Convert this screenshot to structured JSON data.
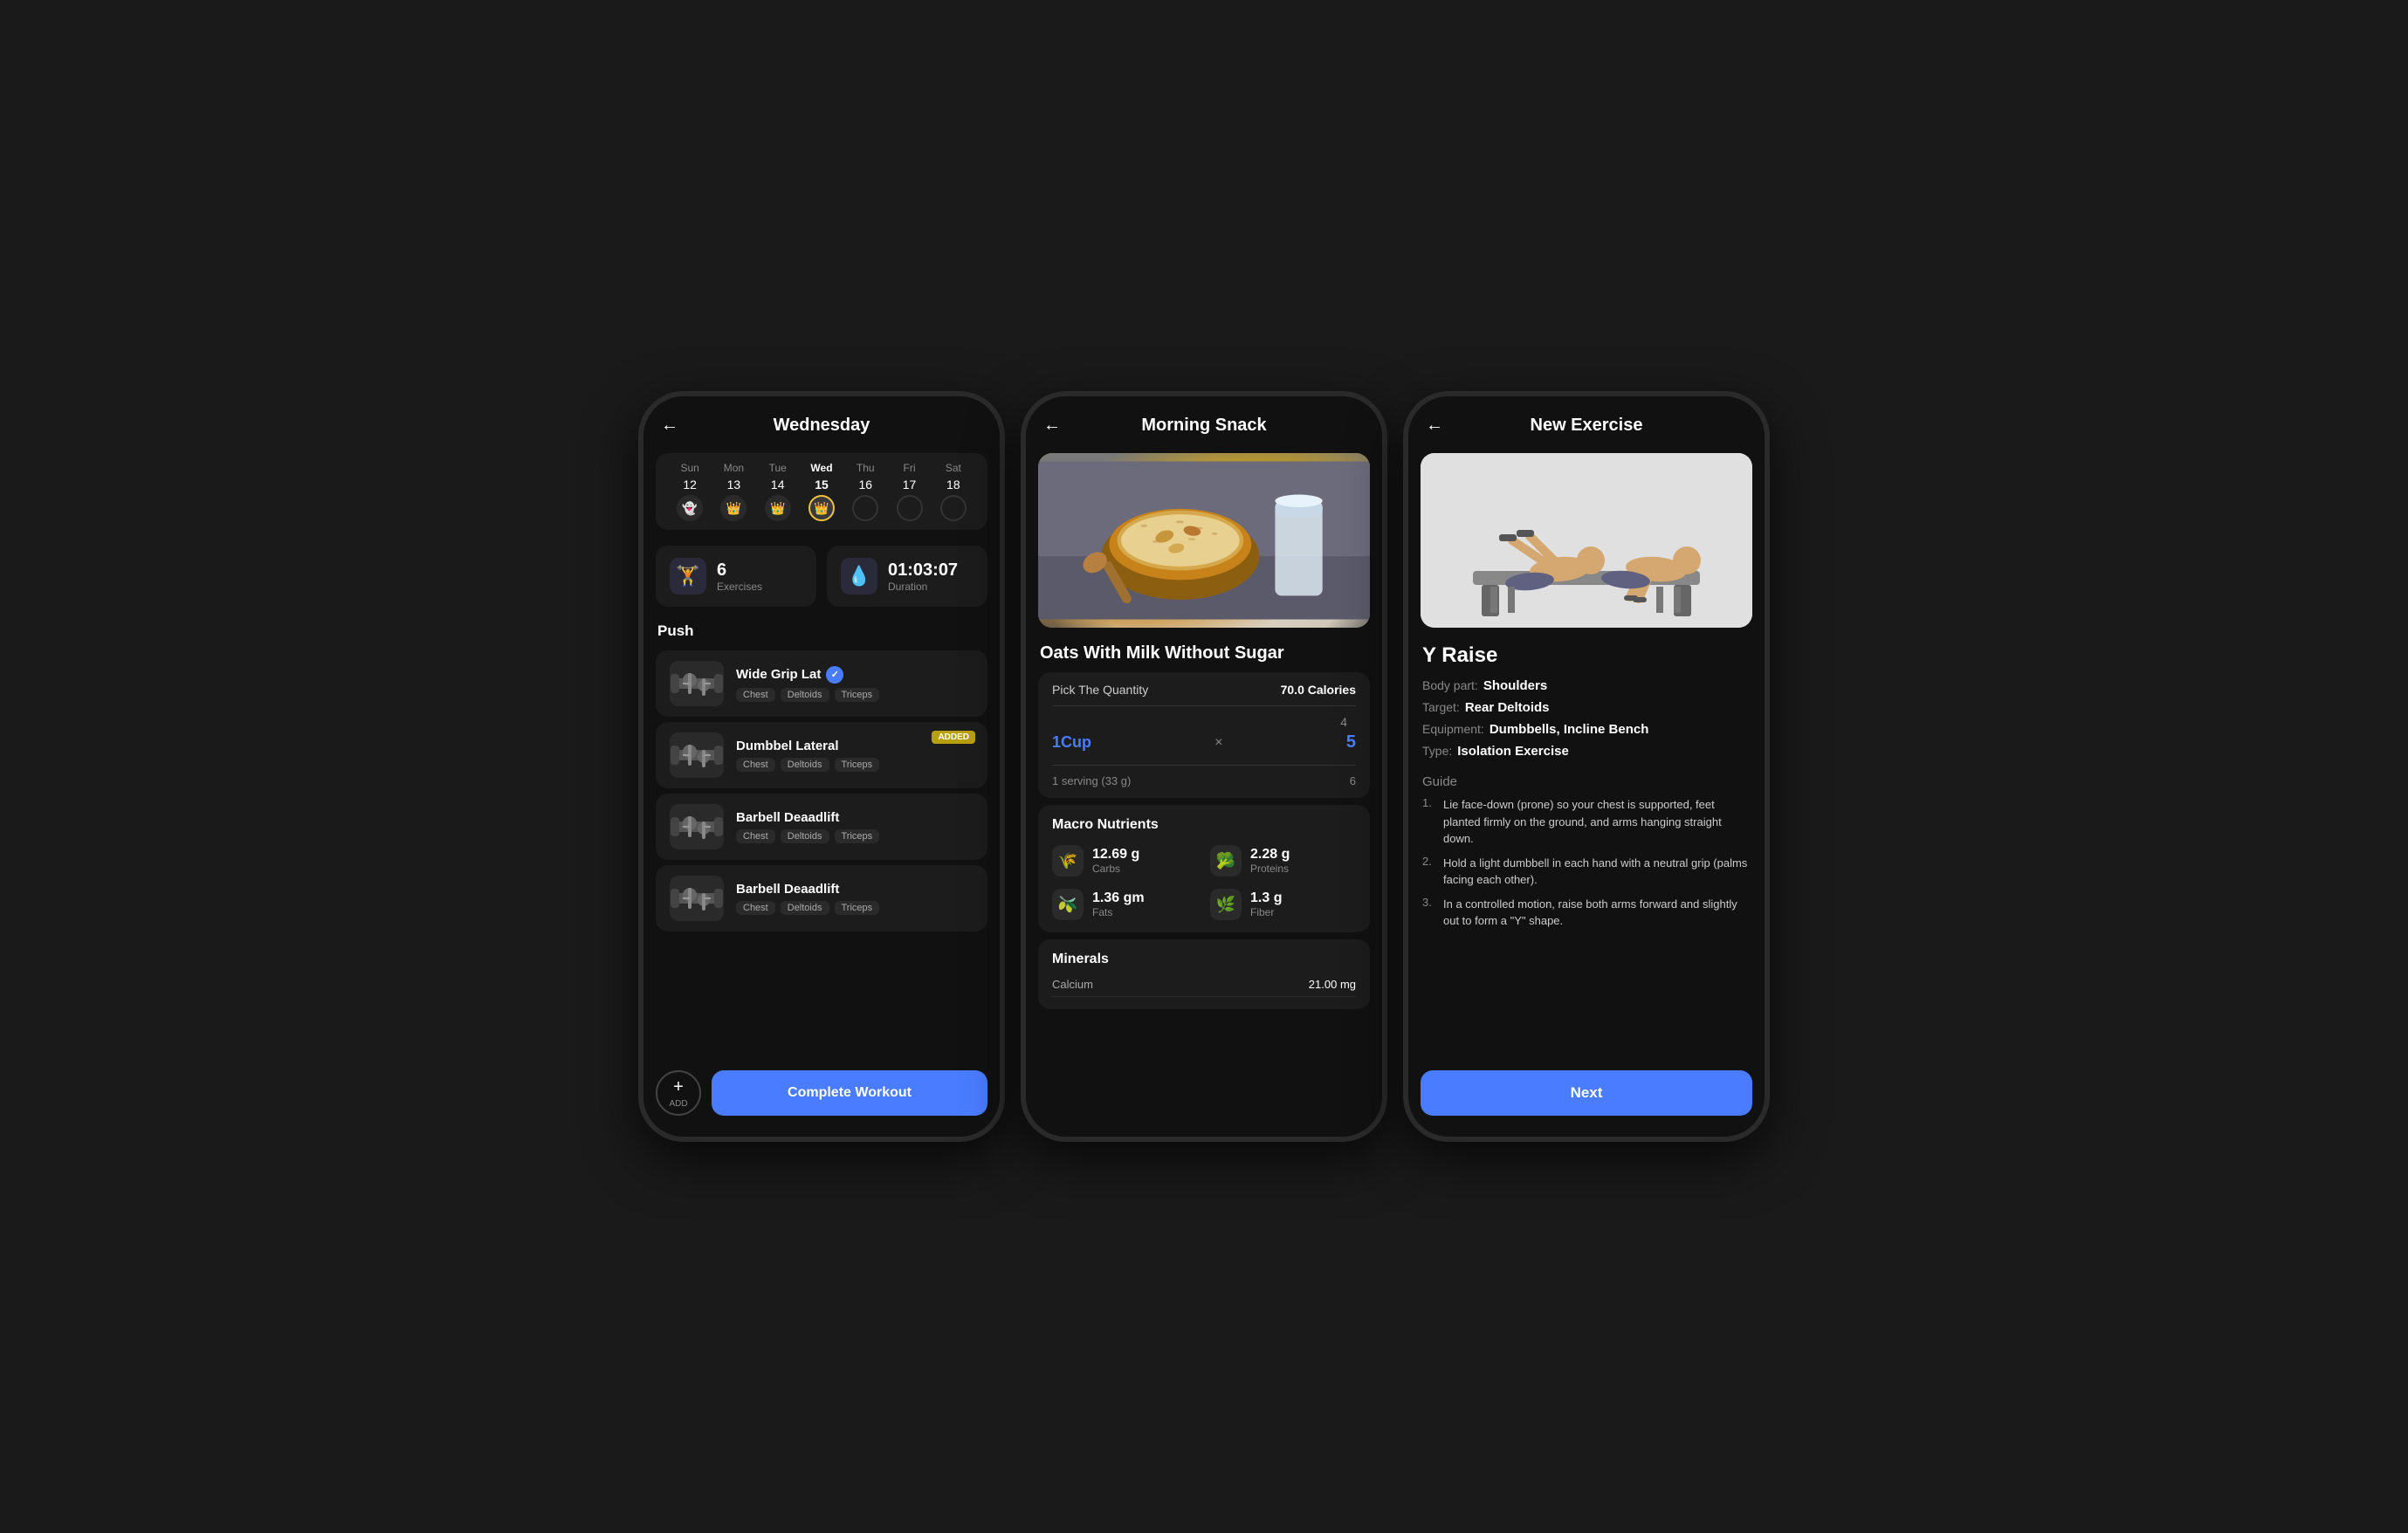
{
  "screen1": {
    "header": {
      "back_icon": "←",
      "title": "Wednesday"
    },
    "calendar": {
      "days": [
        {
          "name": "Sun",
          "num": "12",
          "icon_type": "ghost",
          "icon": "👻",
          "active": false
        },
        {
          "name": "Mon",
          "num": "13",
          "icon_type": "crown",
          "icon": "👑",
          "active": false
        },
        {
          "name": "Tue",
          "num": "14",
          "icon_type": "crown",
          "icon": "👑",
          "active": false
        },
        {
          "name": "Wed",
          "num": "15",
          "icon_type": "crown",
          "icon": "👑",
          "active": true
        },
        {
          "name": "Thu",
          "num": "16",
          "icon_type": "empty",
          "icon": "",
          "active": false
        },
        {
          "name": "Fri",
          "num": "17",
          "icon_type": "empty",
          "icon": "",
          "active": false
        },
        {
          "name": "Sat",
          "num": "18",
          "icon_type": "empty",
          "icon": "",
          "active": false
        }
      ]
    },
    "stats": [
      {
        "icon": "🏋️",
        "value": "6",
        "label": "Exercises"
      },
      {
        "icon": "💧",
        "value": "01:03:07",
        "label": "Duration"
      }
    ],
    "section_title": "Push",
    "exercises": [
      {
        "name": "Wide Grip Lat",
        "has_check": true,
        "has_added": false,
        "tags": [
          "Chest",
          "Deltoids",
          "Triceps"
        ],
        "icon": "🏋"
      },
      {
        "name": "Dumbbel Lateral",
        "has_check": false,
        "has_added": true,
        "tags": [
          "Chest",
          "Deltoids",
          "Triceps"
        ],
        "icon": "🏋"
      },
      {
        "name": "Barbell Deaadlift",
        "has_check": false,
        "has_added": false,
        "tags": [
          "Chest",
          "Deltoids",
          "Triceps"
        ],
        "icon": "🏋"
      },
      {
        "name": "Barbell Deaadlift",
        "has_check": false,
        "has_added": false,
        "tags": [
          "Chest",
          "Deltoids",
          "Triceps"
        ],
        "icon": "🏋"
      }
    ],
    "bottom": {
      "add_icon": "+",
      "add_label": "ADD",
      "complete_label": "Complete Workout"
    }
  },
  "screen2": {
    "header": {
      "back_icon": "←",
      "title": "Morning Snack"
    },
    "food_title": "Oats With Milk Without Sugar",
    "quantity": {
      "label": "Pick The Quantity",
      "calories": "70.0 Calories",
      "rows": [
        "4",
        "1Cup",
        "1 serving (33 g)"
      ],
      "multiplier_label": "1Cup",
      "x_label": "×",
      "selected_num": "5",
      "serving_label": "1 serving (33 g)",
      "num_bottom": "6"
    },
    "macros": {
      "title": "Macro Nutrients",
      "items": [
        {
          "icon": "🌾",
          "value": "12.69 g",
          "name": "Carbs"
        },
        {
          "icon": "🥦",
          "value": "2.28 g",
          "name": "Proteins"
        },
        {
          "icon": "🫒",
          "value": "1.36 gm",
          "name": "Fats"
        },
        {
          "icon": "🌿",
          "value": "1.3 g",
          "name": "Fiber"
        }
      ]
    },
    "minerals": {
      "title": "Minerals",
      "items": [
        {
          "name": "Calcium",
          "value": "21.00 mg"
        }
      ]
    }
  },
  "screen3": {
    "header": {
      "back_icon": "←",
      "title": "New Exercise"
    },
    "exercise_title": "Y Raise",
    "meta": [
      {
        "key": "Body part:",
        "value": "Shoulders"
      },
      {
        "key": "Target:",
        "value": "Rear Deltoids"
      },
      {
        "key": "Equipment:",
        "value": "Dumbbells, Incline Bench"
      },
      {
        "key": "Type:",
        "value": "Isolation Exercise"
      }
    ],
    "guide_title": "Guide",
    "guide_steps": [
      "Lie face-down (prone) so your chest is supported, feet planted firmly on the ground, and arms hanging straight down.",
      "Hold a light dumbbell in each hand with a neutral grip (palms facing each other).",
      "In a controlled motion, raise both arms forward and slightly out to form a \"Y\" shape."
    ],
    "next_button": "Next"
  }
}
